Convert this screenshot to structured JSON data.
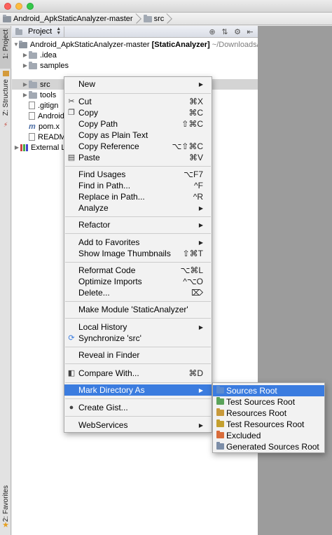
{
  "breadcrumb": [
    "Android_ApkStaticAnalyzer-master",
    "src"
  ],
  "left_tabs": {
    "project": "1: Project",
    "structure": "Z: Structure",
    "favorites": "2: Favorites"
  },
  "panel": {
    "view_label": "Project"
  },
  "tree": {
    "root_name": "Android_ApkStaticAnalyzer-master",
    "root_module": "[StaticAnalyzer]",
    "root_path": "~/Downloads/",
    "items": [
      ".idea",
      "samples",
      "src",
      "tools",
      ".gitign",
      "Android",
      "pom.x",
      "READM"
    ],
    "external": "External L"
  },
  "context_menu": {
    "new": "New",
    "cut": "Cut",
    "cut_sc": "⌘X",
    "copy": "Copy",
    "copy_sc": "⌘C",
    "copy_path": "Copy Path",
    "copy_path_sc": "⇧⌘C",
    "copy_plain": "Copy as Plain Text",
    "copy_ref": "Copy Reference",
    "copy_ref_sc": "⌥⇧⌘C",
    "paste": "Paste",
    "paste_sc": "⌘V",
    "find_usages": "Find Usages",
    "find_usages_sc": "⌥F7",
    "find_in_path": "Find in Path...",
    "find_in_path_sc": "^F",
    "replace_in_path": "Replace in Path...",
    "replace_in_path_sc": "^R",
    "analyze": "Analyze",
    "refactor": "Refactor",
    "add_favorites": "Add to Favorites",
    "thumbnails": "Show Image Thumbnails",
    "thumbnails_sc": "⇧⌘T",
    "reformat": "Reformat Code",
    "reformat_sc": "⌥⌘L",
    "optimize": "Optimize Imports",
    "optimize_sc": "^⌥O",
    "delete": "Delete...",
    "delete_sc": "⌦",
    "make_module": "Make Module 'StaticAnalyzer'",
    "local_history": "Local History",
    "synchronize": "Synchronize 'src'",
    "reveal": "Reveal in Finder",
    "compare": "Compare With...",
    "compare_sc": "⌘D",
    "mark_dir": "Mark Directory As",
    "create_gist": "Create Gist...",
    "webservices": "WebServices"
  },
  "submenu": {
    "sources_root": "Sources Root",
    "test_sources_root": "Test Sources Root",
    "resources_root": "Resources Root",
    "test_resources_root": "Test Resources Root",
    "excluded": "Excluded",
    "generated_sources_root": "Generated Sources Root"
  },
  "colors": {
    "highlight": "#3b7cdf",
    "editor_bg": "#9c9c9c"
  }
}
